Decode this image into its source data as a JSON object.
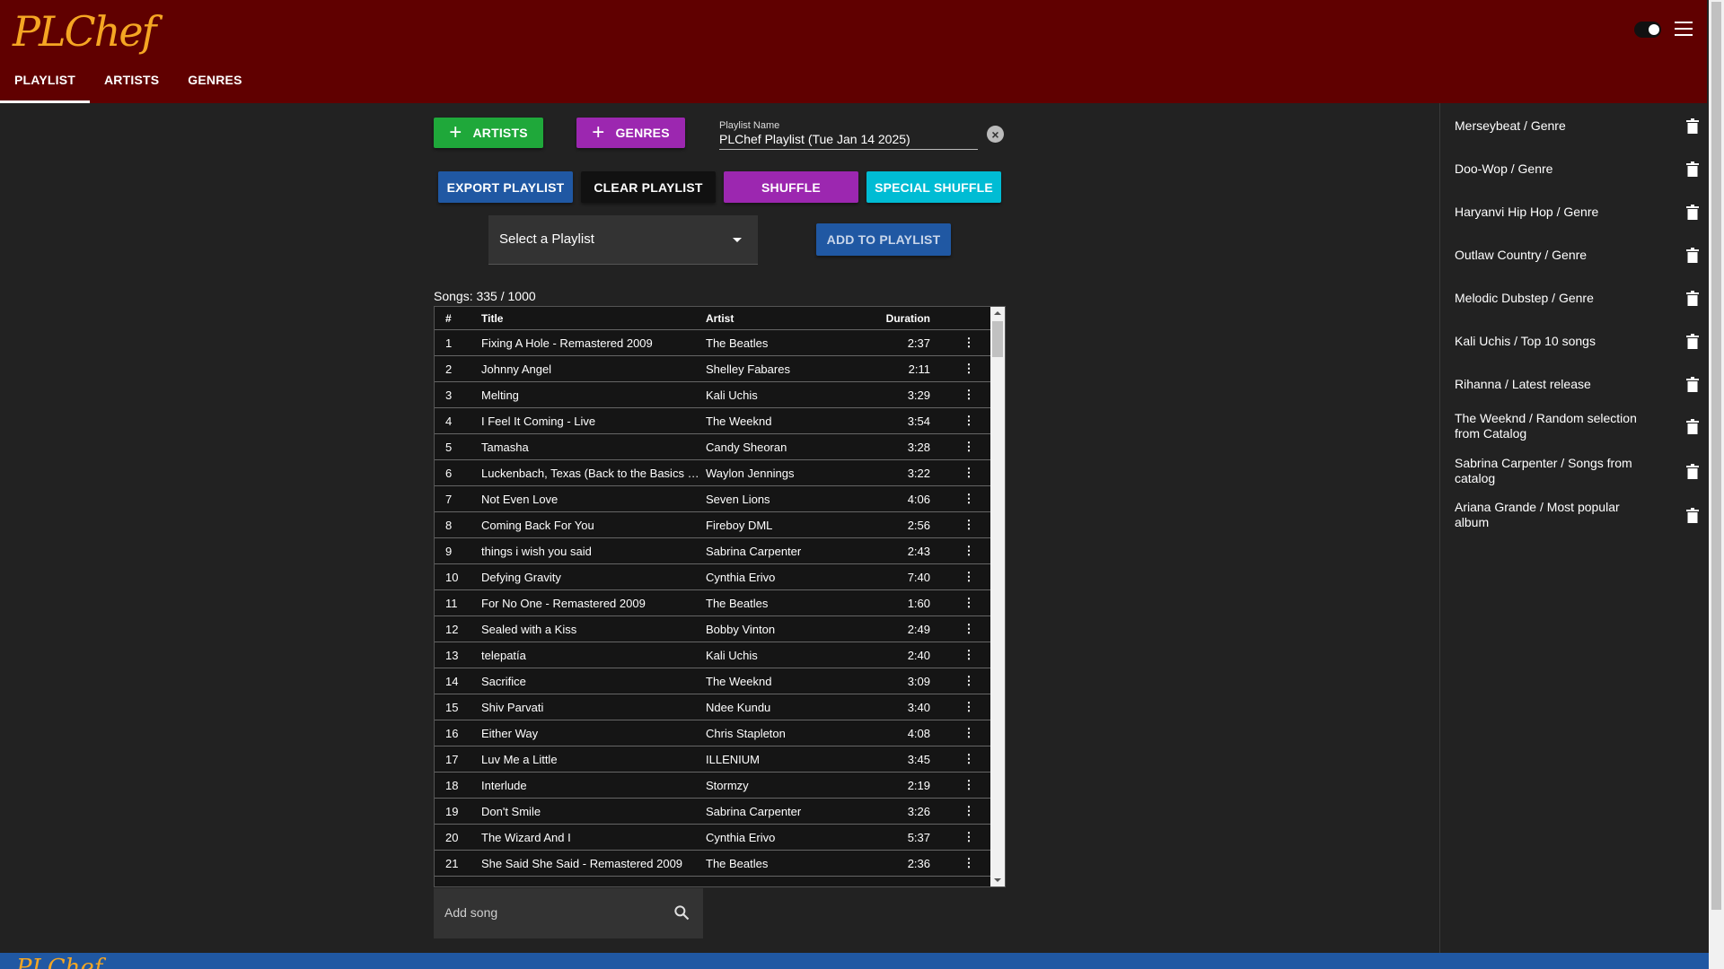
{
  "app": {
    "logo": "PLChef"
  },
  "nav": {
    "tabs": [
      "PLAYLIST",
      "ARTISTS",
      "GENRES"
    ]
  },
  "toolbar": {
    "artists_label": "ARTISTS",
    "genres_label": "GENRES",
    "playlist_name_label": "Playlist Name",
    "playlist_name_value": "PLChef Playlist (Tue Jan 14 2025)",
    "export_label": "EXPORT PLAYLIST",
    "clear_label": "CLEAR PLAYLIST",
    "shuffle_label": "SHUFFLE",
    "special_shuffle_label": "SPECIAL SHUFFLE",
    "select_playlist_value": "Select a Playlist",
    "add_to_playlist_label": "ADD TO PLAYLIST"
  },
  "songs_count": "Songs: 335 / 1000",
  "table": {
    "headers": {
      "num": "#",
      "title": "Title",
      "artist": "Artist",
      "duration": "Duration"
    },
    "rows": [
      {
        "num": "1",
        "title": "Fixing A Hole - Remastered 2009",
        "artist": "The Beatles",
        "duration": "2:37"
      },
      {
        "num": "2",
        "title": "Johnny Angel",
        "artist": "Shelley Fabares",
        "duration": "2:11"
      },
      {
        "num": "3",
        "title": "Melting",
        "artist": "Kali Uchis",
        "duration": "3:29"
      },
      {
        "num": "4",
        "title": "I Feel It Coming - Live",
        "artist": "The Weeknd",
        "duration": "3:54"
      },
      {
        "num": "5",
        "title": "Tamasha",
        "artist": "Candy Sheoran",
        "duration": "3:28"
      },
      {
        "num": "6",
        "title": "Luckenbach, Texas (Back to the Basics of Love)",
        "artist": "Waylon Jennings",
        "duration": "3:22"
      },
      {
        "num": "7",
        "title": "Not Even Love",
        "artist": "Seven Lions",
        "duration": "4:06"
      },
      {
        "num": "8",
        "title": "Coming Back For You",
        "artist": "Fireboy DML",
        "duration": "2:56"
      },
      {
        "num": "9",
        "title": "things i wish you said",
        "artist": "Sabrina Carpenter",
        "duration": "2:43"
      },
      {
        "num": "10",
        "title": "Defying Gravity",
        "artist": "Cynthia Erivo",
        "duration": "7:40"
      },
      {
        "num": "11",
        "title": "For No One - Remastered 2009",
        "artist": "The Beatles",
        "duration": "1:60"
      },
      {
        "num": "12",
        "title": "Sealed with a Kiss",
        "artist": "Bobby Vinton",
        "duration": "2:49"
      },
      {
        "num": "13",
        "title": "telepatía",
        "artist": "Kali Uchis",
        "duration": "2:40"
      },
      {
        "num": "14",
        "title": "Sacrifice",
        "artist": "The Weeknd",
        "duration": "3:09"
      },
      {
        "num": "15",
        "title": "Shiv Parvati",
        "artist": "Ndee Kundu",
        "duration": "3:40"
      },
      {
        "num": "16",
        "title": "Either Way",
        "artist": "Chris Stapleton",
        "duration": "4:08"
      },
      {
        "num": "17",
        "title": "Luv Me a Little",
        "artist": "ILLENIUM",
        "duration": "3:45"
      },
      {
        "num": "18",
        "title": "Interlude",
        "artist": "Stormzy",
        "duration": "2:19"
      },
      {
        "num": "19",
        "title": "Don't Smile",
        "artist": "Sabrina Carpenter",
        "duration": "3:26"
      },
      {
        "num": "20",
        "title": "The Wizard And I",
        "artist": "Cynthia Erivo",
        "duration": "5:37"
      },
      {
        "num": "21",
        "title": "She Said She Said - Remastered 2009",
        "artist": "The Beatles",
        "duration": "2:36"
      }
    ]
  },
  "add_song": {
    "placeholder": "Add song"
  },
  "sources": [
    "Merseybeat / Genre",
    "Doo-Wop / Genre",
    "Haryanvi Hip Hop / Genre",
    "Outlaw Country / Genre",
    "Melodic Dubstep / Genre",
    "Kali Uchis / Top 10 songs",
    "Rihanna / Latest release",
    "The Weeknd / Random selection from Catalog",
    "Sabrina Carpenter / Songs from catalog",
    "Ariana Grande / Most popular album"
  ],
  "colors": {
    "header_bg": "#600000",
    "logo": "#f5a623",
    "artists_btn": "#1fa83a",
    "genres_btn": "#9c27b0",
    "export_btn": "#2058a3",
    "special_shuffle_btn": "#00bcd4",
    "footer_bg": "#2058a3"
  }
}
